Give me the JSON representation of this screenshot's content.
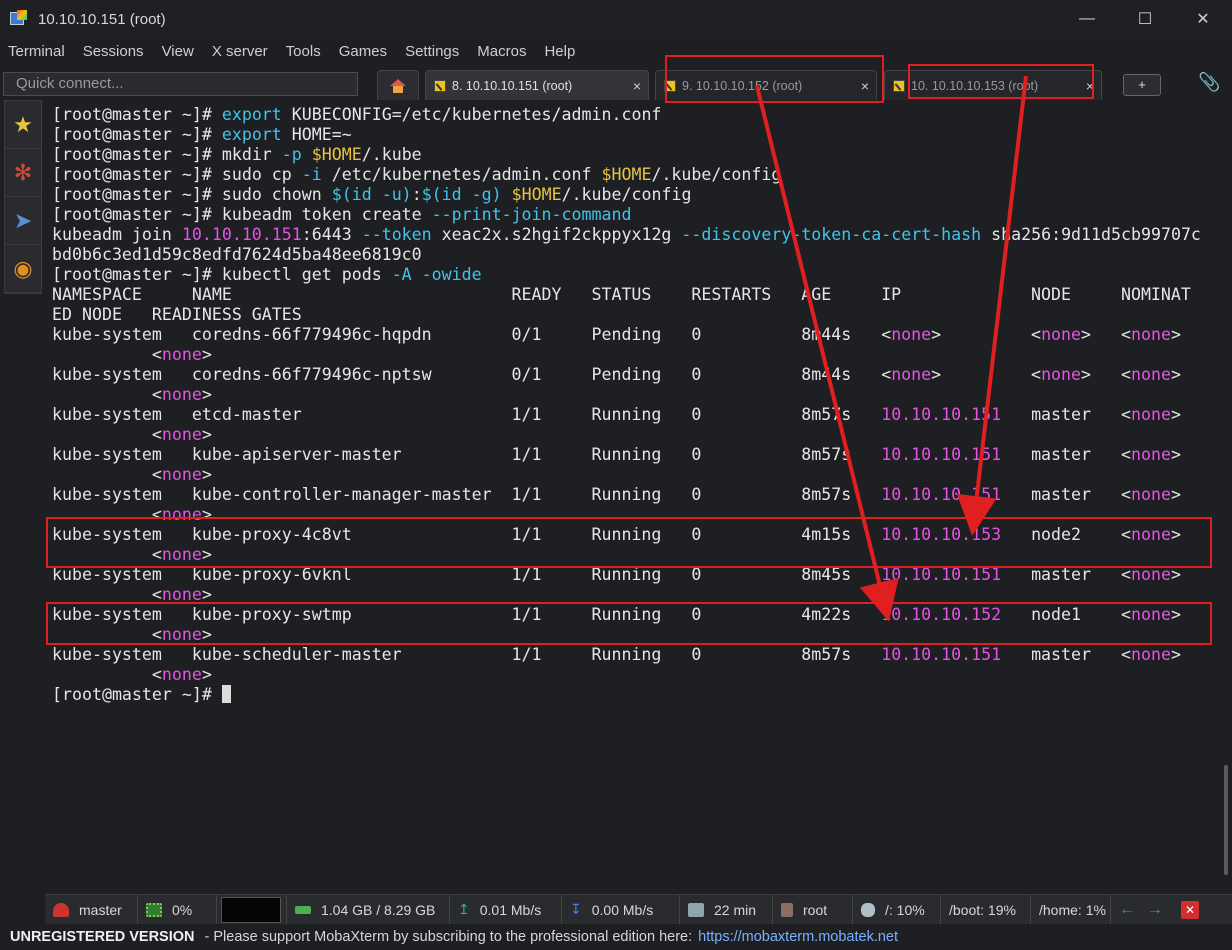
{
  "window": {
    "title": "10.10.10.151 (root)",
    "controls": [
      "—",
      "☐",
      "✕"
    ]
  },
  "menu": [
    "Terminal",
    "Sessions",
    "View",
    "X server",
    "Tools",
    "Games",
    "Settings",
    "Macros",
    "Help"
  ],
  "quick_connect": {
    "placeholder": "Quick connect..."
  },
  "tabs": [
    {
      "label": "8. 10.10.10.151 (root)",
      "close": "×"
    },
    {
      "label": "9. 10.10.10.152 (root)",
      "close": "×"
    },
    {
      "label": "10. 10.10.10.153 (root)",
      "close": "×"
    }
  ],
  "new_tab_label": "+",
  "terminal": {
    "prompt": "[root@master ~]# ",
    "lines": [
      {
        "parts": [
          [
            "p",
            "[root@master ~]# "
          ],
          [
            "c",
            "export"
          ],
          [
            "t",
            " KUBECONFIG=/etc/kubernetes/admin.conf"
          ]
        ]
      },
      {
        "parts": [
          [
            "p",
            "[root@master ~]# "
          ],
          [
            "c",
            "export"
          ],
          [
            "t",
            " HOME=~"
          ]
        ]
      },
      {
        "parts": [
          [
            "p",
            "[root@master ~]# "
          ],
          [
            "t",
            "mkdir "
          ],
          [
            "c",
            "-p"
          ],
          [
            "t",
            " "
          ],
          [
            "v",
            "$HOME"
          ],
          [
            "t",
            "/.kube"
          ]
        ]
      },
      {
        "parts": [
          [
            "p",
            "[root@master ~]# "
          ],
          [
            "t",
            "sudo cp "
          ],
          [
            "c",
            "-i"
          ],
          [
            "t",
            " /etc/kubernetes/admin.conf "
          ],
          [
            "v",
            "$HOME"
          ],
          [
            "t",
            "/.kube/config"
          ]
        ]
      },
      {
        "parts": [
          [
            "p",
            "[root@master ~]# "
          ],
          [
            "t",
            "sudo chown "
          ],
          [
            "c",
            "$(id -u)"
          ],
          [
            "t",
            ":"
          ],
          [
            "c",
            "$(id -g)"
          ],
          [
            "t",
            " "
          ],
          [
            "v",
            "$HOME"
          ],
          [
            "t",
            "/.kube/config"
          ]
        ]
      },
      {
        "parts": [
          [
            "p",
            "[root@master ~]# "
          ],
          [
            "t",
            "kubeadm token create "
          ],
          [
            "c",
            "--print-join-command"
          ]
        ]
      },
      {
        "parts": [
          [
            "t",
            "kubeadm join "
          ],
          [
            "m",
            "10.10.10.151"
          ],
          [
            "t",
            ":6443 "
          ],
          [
            "c",
            "--token"
          ],
          [
            "t",
            " xeac2x.s2hgif2ckppyx12g "
          ],
          [
            "c",
            "--discovery-token-ca-cert-hash"
          ],
          [
            "t",
            " sha256:9d11d5cb99707c"
          ]
        ]
      },
      {
        "parts": [
          [
            "t",
            "bd0b6c3ed1d59c8edfd7624d5ba48ee6819c0"
          ]
        ]
      },
      {
        "parts": [
          [
            "p",
            "[root@master ~]# "
          ],
          [
            "t",
            "kubectl get pods "
          ],
          [
            "c",
            "-A -owide"
          ]
        ]
      },
      {
        "parts": [
          [
            "t",
            "NAMESPACE     NAME                            READY   STATUS    RESTARTS   AGE     IP             NODE     NOMINAT"
          ]
        ]
      },
      {
        "parts": [
          [
            "t",
            "ED NODE   READINESS GATES"
          ]
        ]
      },
      {
        "parts": [
          [
            "t",
            "kube-system   coredns-66f779496c-hqpdn        0/1     Pending   0          8m44s   <"
          ],
          [
            "m",
            "none"
          ],
          [
            "t",
            ">         <"
          ],
          [
            "m",
            "none"
          ],
          [
            "t",
            ">   <"
          ],
          [
            "m",
            "none"
          ],
          [
            "t",
            ">"
          ]
        ]
      },
      {
        "parts": [
          [
            "t",
            "          <"
          ],
          [
            "m",
            "none"
          ],
          [
            "t",
            ">"
          ]
        ]
      },
      {
        "parts": [
          [
            "t",
            "kube-system   coredns-66f779496c-nptsw        0/1     Pending   0          8m44s   <"
          ],
          [
            "m",
            "none"
          ],
          [
            "t",
            ">         <"
          ],
          [
            "m",
            "none"
          ],
          [
            "t",
            ">   <"
          ],
          [
            "m",
            "none"
          ],
          [
            "t",
            ">"
          ]
        ]
      },
      {
        "parts": [
          [
            "t",
            "          <"
          ],
          [
            "m",
            "none"
          ],
          [
            "t",
            ">"
          ]
        ]
      },
      {
        "parts": [
          [
            "t",
            "kube-system   etcd-master                     1/1     Running   0          8m57s   "
          ],
          [
            "m",
            "10.10.10.151"
          ],
          [
            "t",
            "   master   <"
          ],
          [
            "m",
            "none"
          ],
          [
            "t",
            ">"
          ]
        ]
      },
      {
        "parts": [
          [
            "t",
            "          <"
          ],
          [
            "m",
            "none"
          ],
          [
            "t",
            ">"
          ]
        ]
      },
      {
        "parts": [
          [
            "t",
            "kube-system   kube-apiserver-master           1/1     Running   0          8m57s   "
          ],
          [
            "m",
            "10.10.10.151"
          ],
          [
            "t",
            "   master   <"
          ],
          [
            "m",
            "none"
          ],
          [
            "t",
            ">"
          ]
        ]
      },
      {
        "parts": [
          [
            "t",
            "          <"
          ],
          [
            "m",
            "none"
          ],
          [
            "t",
            ">"
          ]
        ]
      },
      {
        "parts": [
          [
            "t",
            "kube-system   kube-controller-manager-master  1/1     Running   0          8m57s   "
          ],
          [
            "m",
            "10.10.10.151"
          ],
          [
            "t",
            "   master   <"
          ],
          [
            "m",
            "none"
          ],
          [
            "t",
            ">"
          ]
        ]
      },
      {
        "parts": [
          [
            "t",
            "          <"
          ],
          [
            "m",
            "none"
          ],
          [
            "t",
            ">"
          ]
        ]
      },
      {
        "parts": [
          [
            "t",
            "kube-system   kube-proxy-4c8vt                1/1     Running   0          4m15s   "
          ],
          [
            "m",
            "10.10.10.153"
          ],
          [
            "t",
            "   node2    <"
          ],
          [
            "m",
            "none"
          ],
          [
            "t",
            ">"
          ]
        ]
      },
      {
        "parts": [
          [
            "t",
            "          <"
          ],
          [
            "m",
            "none"
          ],
          [
            "t",
            ">"
          ]
        ]
      },
      {
        "parts": [
          [
            "t",
            "kube-system   kube-proxy-6vknl                1/1     Running   0          8m45s   "
          ],
          [
            "m",
            "10.10.10.151"
          ],
          [
            "t",
            "   master   <"
          ],
          [
            "m",
            "none"
          ],
          [
            "t",
            ">"
          ]
        ]
      },
      {
        "parts": [
          [
            "t",
            "          <"
          ],
          [
            "m",
            "none"
          ],
          [
            "t",
            ">"
          ]
        ]
      },
      {
        "parts": [
          [
            "t",
            "kube-system   kube-proxy-swtmp                1/1     Running   0          4m22s   "
          ],
          [
            "m",
            "10.10.10.152"
          ],
          [
            "t",
            "   node1    <"
          ],
          [
            "m",
            "none"
          ],
          [
            "t",
            ">"
          ]
        ]
      },
      {
        "parts": [
          [
            "t",
            "          <"
          ],
          [
            "m",
            "none"
          ],
          [
            "t",
            ">"
          ]
        ]
      },
      {
        "parts": [
          [
            "t",
            "kube-system   kube-scheduler-master           1/1     Running   0          8m57s   "
          ],
          [
            "m",
            "10.10.10.151"
          ],
          [
            "t",
            "   master   <"
          ],
          [
            "m",
            "none"
          ],
          [
            "t",
            ">"
          ]
        ]
      },
      {
        "parts": [
          [
            "t",
            "          <"
          ],
          [
            "m",
            "none"
          ],
          [
            "t",
            ">"
          ]
        ]
      },
      {
        "parts": [
          [
            "p",
            "[root@master ~]# "
          ],
          [
            "k",
            ""
          ]
        ]
      }
    ]
  },
  "status": {
    "host": "master",
    "cpu": "0%",
    "memory": "1.04 GB / 8.29 GB",
    "upload": "0.01 Mb/s",
    "download": "0.00 Mb/s",
    "uptime": "22 min",
    "user": "root",
    "disk_root": "/: 10%",
    "disk_boot": "/boot: 19%",
    "disk_home": "/home: 1%"
  },
  "footer": {
    "unregistered": "UNREGISTERED VERSION",
    "message": "-  Please support MobaXterm by subscribing to the professional edition here:",
    "link": "https://mobaxterm.mobatek.net"
  },
  "colors": {
    "command": "#3fc4e8",
    "variable": "#e8c43f",
    "highlight": "#e455e4",
    "annotation": "#e02020"
  }
}
